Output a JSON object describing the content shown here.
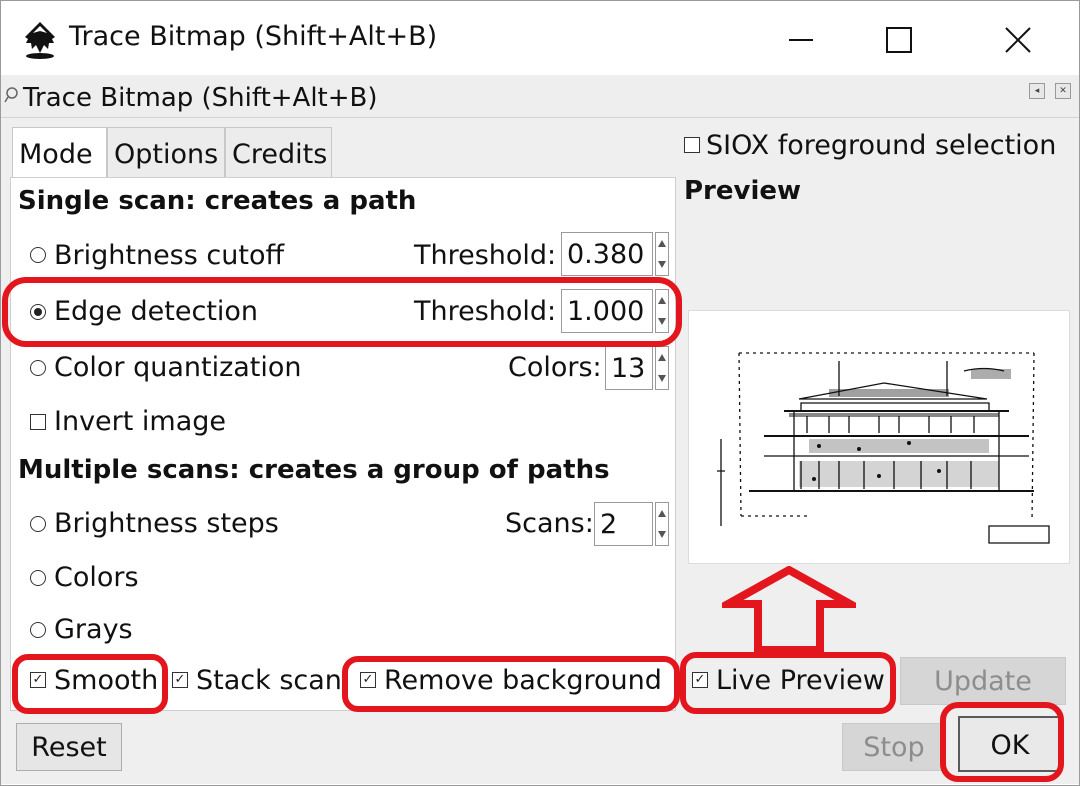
{
  "window": {
    "title": "Trace Bitmap (Shift+Alt+B)",
    "controls": [
      "minimize",
      "maximize",
      "close"
    ]
  },
  "dock": {
    "title": "Trace Bitmap (Shift+Alt+B)"
  },
  "tabs": [
    {
      "label": "Mode",
      "active": true
    },
    {
      "label": "Options",
      "active": false
    },
    {
      "label": "Credits",
      "active": false
    }
  ],
  "single_scan": {
    "heading": "Single scan: creates a path",
    "brightness": {
      "label": "Brightness cutoff",
      "param_label": "Threshold:",
      "value": "0.380",
      "selected": false
    },
    "edge": {
      "label": "Edge detection",
      "param_label": "Threshold:",
      "value": "1.000",
      "selected": true
    },
    "color_quant": {
      "label": "Color quantization",
      "param_label": "Colors:",
      "value": "13",
      "selected": false
    },
    "invert": {
      "label": "Invert image",
      "checked": false
    }
  },
  "multi_scan": {
    "heading": "Multiple scans: creates a group of paths",
    "brightness_steps": {
      "label": "Brightness steps",
      "param_label": "Scans:",
      "value": "2",
      "selected": false
    },
    "colors": {
      "label": "Colors",
      "selected": false
    },
    "grays": {
      "label": "Grays",
      "selected": false
    }
  },
  "options_row": {
    "smooth": {
      "label": "Smooth",
      "checked": true
    },
    "stack": {
      "label": "Stack scans",
      "checked": true
    },
    "remove_bg": {
      "label": "Remove background",
      "checked": true
    }
  },
  "right": {
    "siox": {
      "label": "SIOX foreground selection",
      "checked": false
    },
    "preview_heading": "Preview",
    "live_preview": {
      "label": "Live Preview",
      "checked": true
    },
    "update_label": "Update"
  },
  "buttons": {
    "reset": "Reset",
    "stop": "Stop",
    "ok": "OK"
  },
  "colors": {
    "highlight": "#e3161d",
    "panel_bg": "#efefef"
  }
}
